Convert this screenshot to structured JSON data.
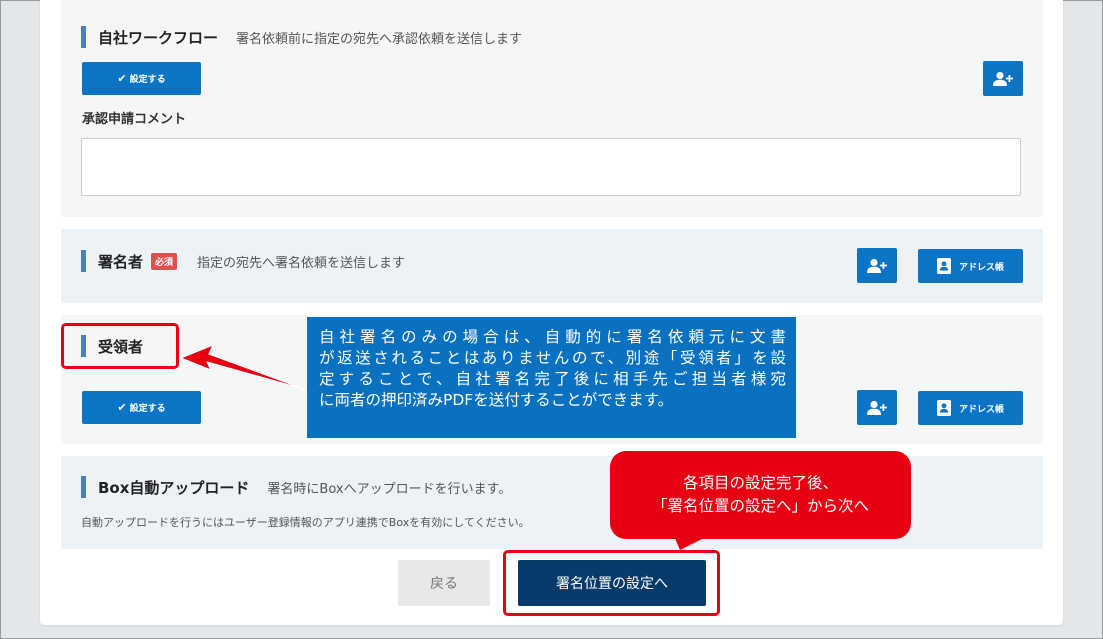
{
  "workflow": {
    "title": "自社ワークフロー",
    "description": "署名依頼前に指定の宛先へ承認依頼を送信します",
    "set_button": "設定する",
    "comment_label": "承認申請コメント",
    "comment_value": ""
  },
  "signer": {
    "title": "署名者",
    "required_badge": "必須",
    "description": "指定の宛先へ署名依頼を送信します",
    "address_button": "アドレス帳"
  },
  "receiver": {
    "title": "受領者",
    "set_button": "設定する",
    "address_button": "アドレス帳"
  },
  "box_upload": {
    "title": "Box自動アップロード",
    "description": "署名時にBoxへアップロードを行います。",
    "note": "自動アップロードを行うにはユーザー登録情報のアプリ連携でBoxを有効にしてください。"
  },
  "footer": {
    "back_button": "戻る",
    "next_button": "署名位置の設定へ"
  },
  "annotations": {
    "blue_callout_lines": [
      "自社署名のみの場合は、自動的に署名依頼元に文書",
      "が返送されることはありませんので、別途「受領者」を設",
      "定することで、自社署名完了後に相手先ご担当者様宛",
      "に両者の押印済みPDFを送付することができます。"
    ],
    "red_callout_lines": [
      "各項目の設定完了後、",
      "「署名位置の設定へ」から次へ"
    ]
  },
  "colors": {
    "primary_button": "#0b74c4",
    "next_button": "#083b6b",
    "annotation_red": "#e60012",
    "annotation_blue": "#0a71c0",
    "section_bar": "#4a7fb8"
  },
  "icons": {
    "add_user": "add-user-icon",
    "address_book": "address-book-icon",
    "check": "check-icon"
  }
}
